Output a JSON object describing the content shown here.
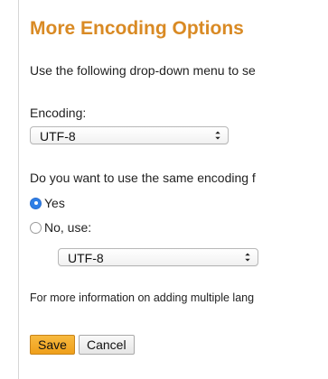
{
  "dialog": {
    "title": "More Encoding Options",
    "intro": "Use the following drop-down menu to se",
    "encoding_label": "Encoding:",
    "encoding_value": "UTF-8",
    "same_encoding_question": "Do you want to use the same encoding f",
    "radio_yes": "Yes",
    "radio_no": "No, use:",
    "radio_selected": "Yes",
    "alt_encoding_value": "UTF-8",
    "footnote": "For more information on adding multiple lang",
    "save_label": "Save",
    "cancel_label": "Cancel"
  },
  "colors": {
    "title": "#d98a24",
    "save_button": "#f2a828",
    "radio_checked": "#2f7fe6"
  }
}
